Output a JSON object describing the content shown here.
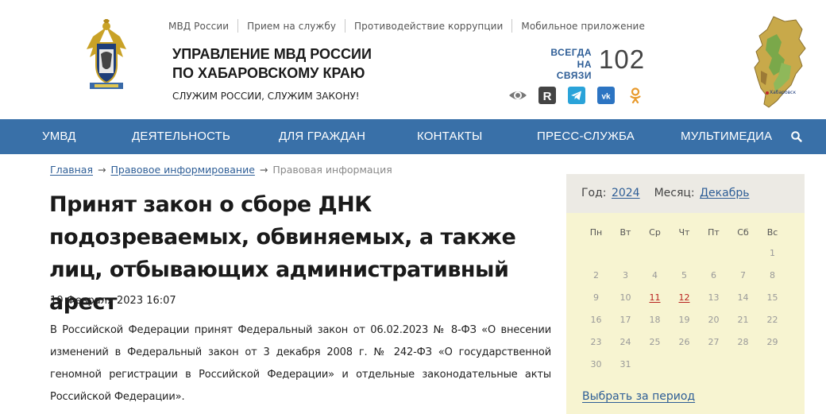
{
  "header": {
    "top_links": [
      "МВД России",
      "Прием на службу",
      "Противодействие коррупции",
      "Мобильное приложение"
    ],
    "org_title_line1": "УПРАВЛЕНИЕ МВД РОССИИ",
    "org_title_line2": "ПО ХАБАРОВСКОМУ КРАЮ",
    "motto": "СЛУЖИМ РОССИИ, СЛУЖИМ ЗАКОНУ!",
    "hotline_label_line1": "ВСЕГДА",
    "hotline_label_line2": "НА СВЯЗИ",
    "hotline_number": "102",
    "social_icons": [
      "eye-icon",
      "rutube-icon",
      "telegram-icon",
      "vk-icon",
      "odnoklassniki-icon"
    ],
    "map_label": "Хабаровск"
  },
  "nav": {
    "items": [
      "УМВД",
      "ДЕЯТЕЛЬНОСТЬ",
      "ДЛЯ ГРАЖДАН",
      "КОНТАКТЫ",
      "ПРЕСС-СЛУЖБА",
      "МУЛЬТИМЕДИА"
    ],
    "search_icon": "search-icon"
  },
  "breadcrumb": {
    "items": [
      "Главная",
      "Правовое информирование",
      "Правовая информация"
    ],
    "separator": "→"
  },
  "article": {
    "title": "Принят закон о сборе ДНК подозреваемых, обвиняемых, а также лиц, отбывающих административный арест",
    "date": "10 Февраля 2023 16:07",
    "body": "В Российской Федерации принят Федеральный закон от 06.02.2023 № 8-ФЗ «О внесении изменений в Федеральный закон от 3 декабря 2008 г. № 242-ФЗ «О государственной геномной регистрации в Российской Федерации» и отдельные законодательные акты Российской Федерации»."
  },
  "calendar": {
    "year_label": "Год:",
    "year": "2024",
    "month_label": "Месяц:",
    "month": "Декабрь",
    "weekdays": [
      "Пн",
      "Вт",
      "Ср",
      "Чт",
      "Пт",
      "Сб",
      "Вс"
    ],
    "weeks": [
      [
        "",
        "",
        "",
        "",
        "",
        "",
        "1"
      ],
      [
        "2",
        "3",
        "4",
        "5",
        "6",
        "7",
        "8"
      ],
      [
        "9",
        "10",
        "11",
        "12",
        "13",
        "14",
        "15"
      ],
      [
        "16",
        "17",
        "18",
        "19",
        "20",
        "21",
        "22"
      ],
      [
        "23",
        "24",
        "25",
        "26",
        "27",
        "28",
        "29"
      ],
      [
        "30",
        "31",
        "",
        "",
        "",
        "",
        ""
      ]
    ],
    "highlighted_days": [
      "11",
      "12"
    ],
    "period_link": "Выбрать за период"
  },
  "colors": {
    "nav_bg": "#3970a8",
    "link": "#2d5d96",
    "calendar_bg": "#f7f4d1",
    "calendar_header_bg": "#eceae4",
    "highlight_day": "#b8201e"
  }
}
